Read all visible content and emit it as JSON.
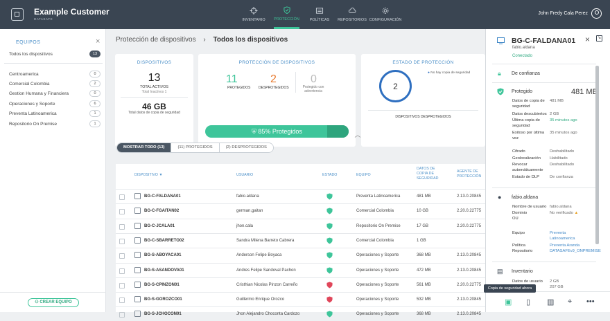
{
  "header": {
    "brand": "Example Customer",
    "brand_sub": "DATASAFE",
    "user": "John Fredy Cala Perez",
    "nav": [
      {
        "label": "INVENTARIO",
        "icon": "crosshair-icon"
      },
      {
        "label": "PROTECCIÓN",
        "icon": "shield-icon"
      },
      {
        "label": "POLÍTICAS",
        "icon": "list-icon"
      },
      {
        "label": "REPOSITORIOS",
        "icon": "cloud-icon"
      },
      {
        "label": "CONFIGURACIÓN",
        "icon": "gear-icon"
      }
    ]
  },
  "sidebar": {
    "title": "EQUIPOS",
    "all": {
      "label": "Todos los dispositivos",
      "count": "13"
    },
    "items": [
      {
        "label": "Centroamerica",
        "count": "0"
      },
      {
        "label": "Comercial Colombia",
        "count": "2"
      },
      {
        "label": "Gestion Humana y Financiera",
        "count": "0"
      },
      {
        "label": "Operaciones y Soporte",
        "count": "6"
      },
      {
        "label": "Preventa Latinoamerica",
        "count": "1"
      },
      {
        "label": "Repositorio On Premise",
        "count": "1"
      }
    ],
    "create_label": "CREAR EQUIPO"
  },
  "breadcrumb": {
    "parent": "Protección de dispositivos",
    "sep": "›",
    "current": "Todos los dispositivos"
  },
  "cards": {
    "devices": {
      "title": "DISPOSITIVOS",
      "total": "13",
      "total_label": "TOTAL ACTIVOS",
      "inactive": "Total Inactivos 1",
      "size": "46 GB",
      "size_label": "Total datos de copia de seguridad"
    },
    "protection": {
      "title": "PROTECCIÓN DE DISPOSITIVOS",
      "protected": "11",
      "protected_label": "PROTEGIDOS",
      "unprotected": "2",
      "unprotected_label": "DESPROTEGIDOS",
      "warning": "0",
      "warning_label": "Protegido con advertencia",
      "bar_label": "85% Protegidos",
      "bar_percent": 85
    },
    "state": {
      "title": "ESTADO DE PROTECCIÓN",
      "legend": "No hay copia de seguridad",
      "value": "2",
      "caption": "DISPOSITIVOS DESPROTEGIDOS"
    }
  },
  "tabs": [
    "MOSTRAR TODO (13)",
    "(11) PROTEGIDOS",
    "(2) DESPROTEGIDOS"
  ],
  "table": {
    "headers": {
      "device": "DISPOSITIVO ▼",
      "user": "USUARIO",
      "state": "ESTADO",
      "team": "EQUIPO",
      "data": "DATOS DE COPIA DE SEGURIDAD",
      "agent": "AGENTE DE PROTECCIÓN"
    },
    "rows": [
      {
        "device": "BG-C-FALDANA01",
        "user": "fabio.aldana",
        "team": "Preventa Latinoamerica",
        "data": "481 MB",
        "agent": "2.13.0.20845",
        "ok": true
      },
      {
        "device": "BG-C-FGAITAN02",
        "user": "german.gaitan",
        "team": "Comercial Colombia",
        "data": "10 GB",
        "agent": "2.20.0.22775",
        "ok": true
      },
      {
        "device": "BG-C-JCALA01",
        "user": "jhon.cala",
        "team": "Repositorio On Premise",
        "data": "17 GB",
        "agent": "2.20.0.22775",
        "ok": true
      },
      {
        "device": "BG-C-SBARRETO02",
        "user": "Sandra Milena Barreto Cabrera",
        "team": "Comercial Colombia",
        "data": "1 GB",
        "agent": "",
        "ok": true
      },
      {
        "device": "BG-S-ABOYACA01",
        "user": "Anderson Felipe Boyaca",
        "team": "Operaciones y Soporte",
        "data": "368 MB",
        "agent": "2.13.0.20845",
        "ok": true
      },
      {
        "device": "BG-S-ASANDOVA01",
        "user": "Andres Felipe Sandoval Pachon",
        "team": "Operaciones y Soporte",
        "data": "472 MB",
        "agent": "2.13.0.20845",
        "ok": true
      },
      {
        "device": "BG-S-CPINZON01",
        "user": "Cristhian Nicolas Pinzon Carreño",
        "team": "Operaciones y Soporte",
        "data": "561 MB",
        "agent": "2.20.0.22775",
        "ok": false
      },
      {
        "device": "BG-S-GOROZCO01",
        "user": "Guillermo Enrique Orozco",
        "team": "Operaciones y Soporte",
        "data": "532 MB",
        "agent": "2.13.0.20845",
        "ok": false
      },
      {
        "device": "BG-S-JCHOCON01",
        "user": "Jhon Alejandro Choconta Cardozo",
        "team": "Operaciones y Soporte",
        "data": "368 MB",
        "agent": "2.13.0.20845",
        "ok": true
      }
    ]
  },
  "panel": {
    "title": "BG-C-FALDANA01",
    "user": "fabio.aldana",
    "status": "Conectado",
    "trust": "De confianza",
    "protected_label": "Protegido",
    "protected_size": "481 MB",
    "details": [
      {
        "k": "Datos de copia de seguridad",
        "v": "481 MB"
      },
      {
        "k": "Datos descubiertos",
        "v": "2 GB"
      },
      {
        "k": "Última copia de seguridad",
        "v": "35 minutos ago"
      },
      {
        "k": "Exitoso por última vez",
        "v": "35 minutos ago"
      }
    ],
    "config": [
      {
        "k": "Cifrado",
        "v": "Deshabilitado"
      },
      {
        "k": "Geolocalización",
        "v": "Habilitado"
      },
      {
        "k": "Revocar automáticamente",
        "v": "Deshabilitado"
      },
      {
        "k": "Estado de DLP",
        "v": "De confianza"
      }
    ],
    "user_section": "fabio.aldana",
    "user_kv": [
      {
        "k": "Nombre de usuario",
        "v": "fabio.aldana"
      },
      {
        "k": "Dominio OU",
        "v": "No verificado"
      },
      {
        "k": "Equipo",
        "v": "Preventa Latinoamerica"
      },
      {
        "k": "Política",
        "v": "Preventa Aranda"
      },
      {
        "k": "Repositorio",
        "v": "DATASAFEv9_ONPREMISE"
      }
    ],
    "inventory": "Inventario",
    "inv_kv": [
      {
        "k": "Datos de usuario",
        "v": "2 GB"
      },
      {
        "k": "",
        "v": "207 GB"
      }
    ],
    "tooltip": "Copia de seguridad ahora"
  }
}
